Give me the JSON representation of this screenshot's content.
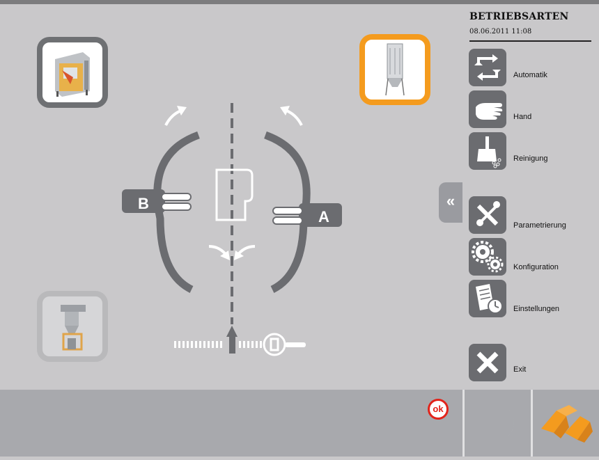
{
  "panel": {
    "title": "BETRIEBSARTEN",
    "datetime": "08.06.2011 11:08",
    "items": [
      {
        "label": "Automatik",
        "icon": "refresh-arrows-icon"
      },
      {
        "label": "Hand",
        "icon": "hand-icon"
      },
      {
        "label": "Reinigung",
        "icon": "broom-icon"
      },
      {
        "label": "Parametrierung",
        "icon": "tools-icon"
      },
      {
        "label": "Konfiguration",
        "icon": "gears-icon"
      },
      {
        "label": "Einstellungen",
        "icon": "document-clock-icon"
      },
      {
        "label": "Exit",
        "icon": "close-icon"
      }
    ],
    "collapse_label": "«"
  },
  "diagram": {
    "side_b_label": "B",
    "side_a_label": "A",
    "center_label": "P"
  },
  "status": {
    "ok_label": "ok"
  },
  "colors": {
    "accent": "#f49b1e",
    "tile_border": "#6e7073",
    "button": "#6b6c70",
    "diagram": "#6b6c70",
    "ok": "#e2231a"
  }
}
